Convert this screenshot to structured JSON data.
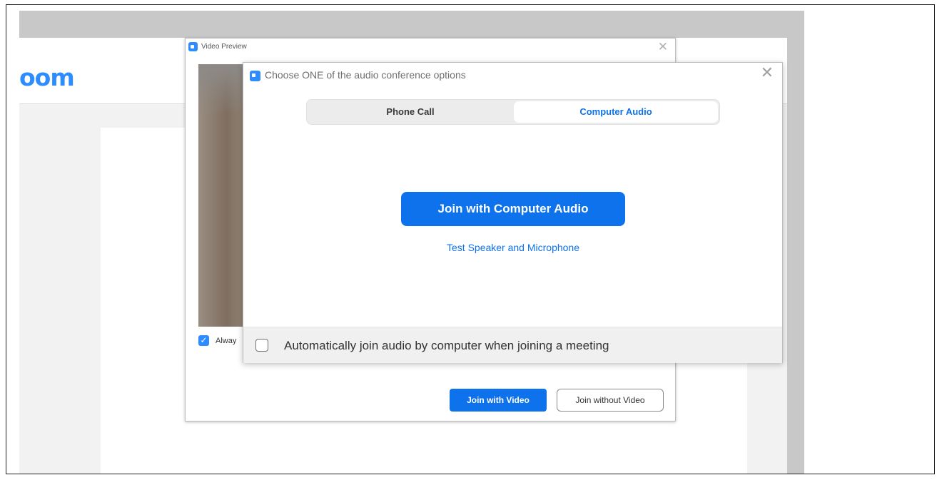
{
  "browser": {
    "logo_text": "oom"
  },
  "video_preview": {
    "title": "Video Preview",
    "close_glyph": "✕",
    "always_label": "Alway",
    "always_checked": true,
    "join_with_video": "Join with Video",
    "join_without_video": "Join without Video"
  },
  "audio_dialog": {
    "title": "Choose ONE of the audio conference options",
    "close_glyph": "✕",
    "tabs": [
      {
        "label": "Phone Call",
        "selected": false
      },
      {
        "label": "Computer Audio",
        "selected": true
      }
    ],
    "join_button": "Join with Computer Audio",
    "test_link": "Test Speaker and Microphone",
    "auto_join_label": "Automatically join audio by computer when joining a meeting",
    "auto_join_checked": false
  },
  "colors": {
    "accent": "#0e72ed",
    "logo_blue": "#2d8cff"
  }
}
